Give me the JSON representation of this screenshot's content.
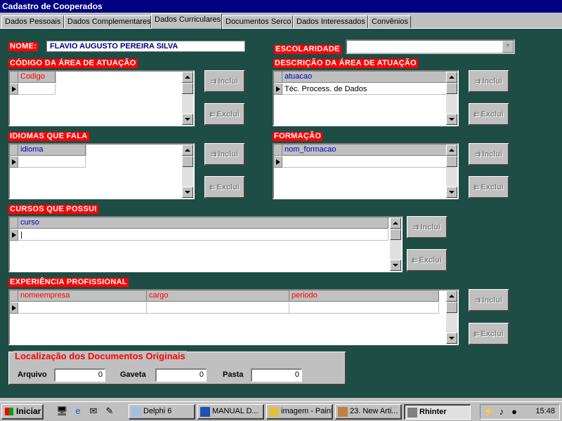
{
  "window": {
    "title": "Cadastro de Cooperados"
  },
  "tabs": [
    {
      "label": "Dados Pessoais"
    },
    {
      "label": "Dados Complementares"
    },
    {
      "label": "Dados Curriculares"
    },
    {
      "label": "Documentos Serco"
    },
    {
      "label": "Dados Interessados"
    },
    {
      "label": "Convênios"
    }
  ],
  "form": {
    "nome_label": "NOME:",
    "nome_value": "FLAVIO AUGUSTO PEREIRA SILVA",
    "escolaridade_label": "ESCOLARIDADE",
    "escolaridade_value": ""
  },
  "sections": {
    "codigo": {
      "label": "CÓDIGO DA ÁREA DE ATUAÇÃO",
      "column": "Codigo",
      "rows": [
        ""
      ]
    },
    "descricao": {
      "label": "DESCRIÇÃO DA ÁREA DE ATUAÇÃO",
      "column": "atuacao",
      "rows": [
        "Téc. Process. de Dados"
      ]
    },
    "idiomas": {
      "label": "IDIOMAS QUE FALA",
      "column": "idioma",
      "rows": [
        ""
      ]
    },
    "formacao": {
      "label": "FORMAÇÃO",
      "column": "nom_formacao",
      "rows": [
        ""
      ]
    },
    "cursos": {
      "label": "CURSOS  QUE POSSUI",
      "column": "curso",
      "rows": [
        "|"
      ]
    },
    "experiencia": {
      "label": "EXPERIÊNCIA PROFISSIONAL",
      "columns": [
        "nomeempresa",
        "cargo",
        "periodo"
      ]
    }
  },
  "buttons": {
    "inclui": "Inclui",
    "exclui": "Exclui"
  },
  "localizacao": {
    "title": "Localização dos Documentos Originais",
    "arquivo_label": "Arquivo",
    "arquivo_value": "0",
    "gaveta_label": "Gaveta",
    "gaveta_value": "0",
    "pasta_label": "Pasta",
    "pasta_value": "0"
  },
  "taskbar": {
    "start": "Iniciar",
    "items": [
      {
        "label": "Delphi 6",
        "icon": "delphi-icon"
      },
      {
        "label": "MANUAL D...",
        "icon": "word-icon"
      },
      {
        "label": "imagem - Paint",
        "icon": "paint-icon"
      },
      {
        "label": "23. New Arti...",
        "icon": "document-icon"
      },
      {
        "label": "Rhinter",
        "icon": "app-icon"
      }
    ],
    "clock": "15:48"
  },
  "colors": {
    "panel": "#1e4d45",
    "label_bg": "#ff0000",
    "title_bar": "#000080"
  }
}
